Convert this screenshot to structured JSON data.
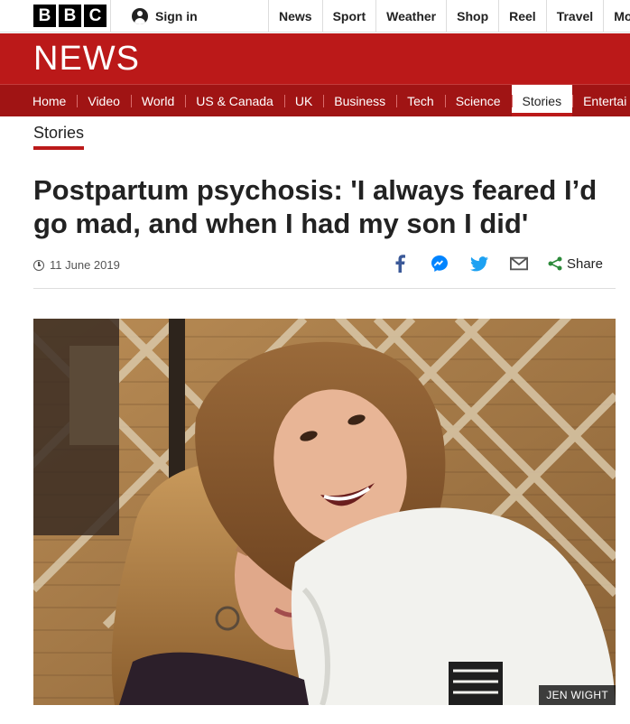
{
  "topbar": {
    "logo_letters": [
      "B",
      "B",
      "C"
    ],
    "sign_in": "Sign in",
    "nav": [
      "News",
      "Sport",
      "Weather",
      "Shop",
      "Reel",
      "Travel",
      "Mor"
    ]
  },
  "masthead": {
    "title": "NEWS"
  },
  "section_nav": {
    "items": [
      "Home",
      "Video",
      "World",
      "US & Canada",
      "UK",
      "Business",
      "Tech",
      "Science",
      "Stories",
      "Entertai"
    ],
    "active": "Stories"
  },
  "article": {
    "section": "Stories",
    "headline": "Postpartum psychosis: 'I always feared I’d go mad, and when I had my son I did'",
    "date": "11 June 2019",
    "share_label": "Share",
    "share_icons": [
      "facebook-icon",
      "messenger-icon",
      "twitter-icon",
      "email-icon",
      "share-icon"
    ],
    "image_credit": "JEN WIGHT"
  },
  "colors": {
    "brand_red": "#bb1919",
    "nav_red": "#a01414",
    "facebook": "#3b5998",
    "messenger": "#0084ff",
    "twitter": "#1da1f2",
    "share_green": "#2c8a3a"
  }
}
